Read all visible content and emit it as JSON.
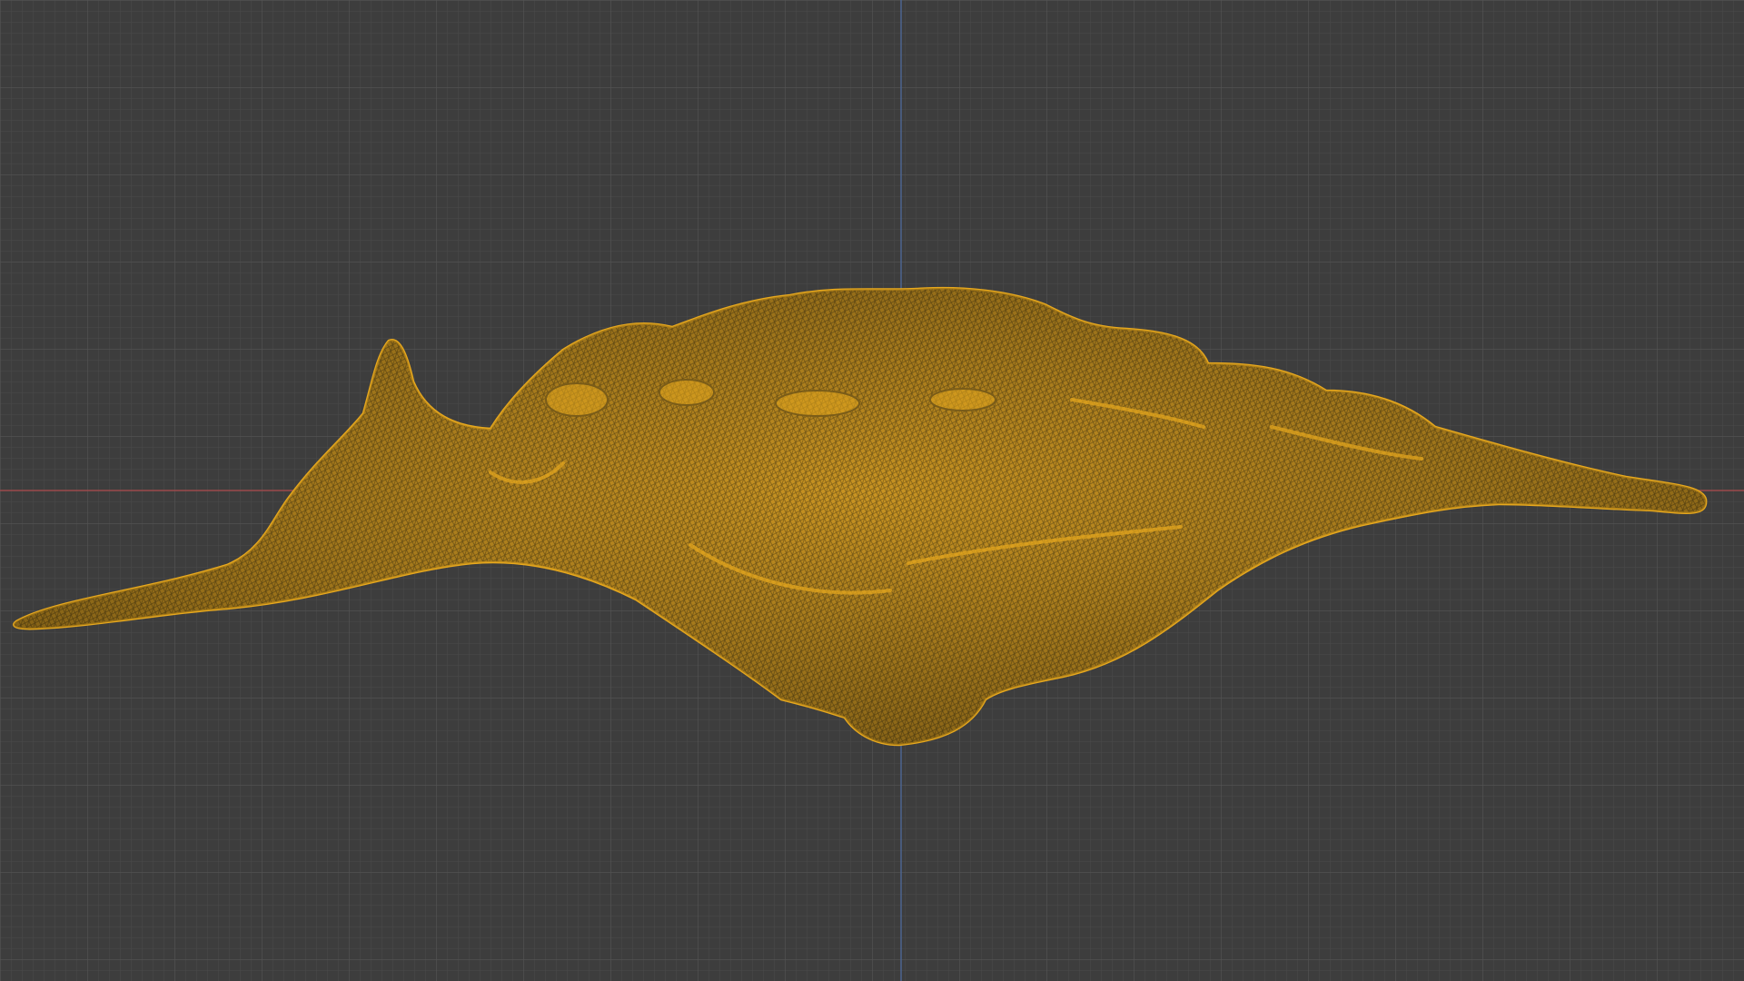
{
  "app": {
    "window_title": "",
    "view": "3d-viewport",
    "shading_mode": "wireframe"
  },
  "viewport": {
    "background_color": "#3d3d3d",
    "grid_minor_color": "#4a4a4a",
    "grid_major_color": "#545454",
    "x_axis_color": "#9b4a4d",
    "z_axis_color": "#4d6590",
    "grid_visible": true,
    "axes_visible": true
  },
  "object": {
    "type": "mesh",
    "state": "selected",
    "wire_color": "#e8a91e",
    "fill_color": "#c99422",
    "shadow_color": "#7a5c18",
    "description_icon": "mesh-object-icon"
  }
}
